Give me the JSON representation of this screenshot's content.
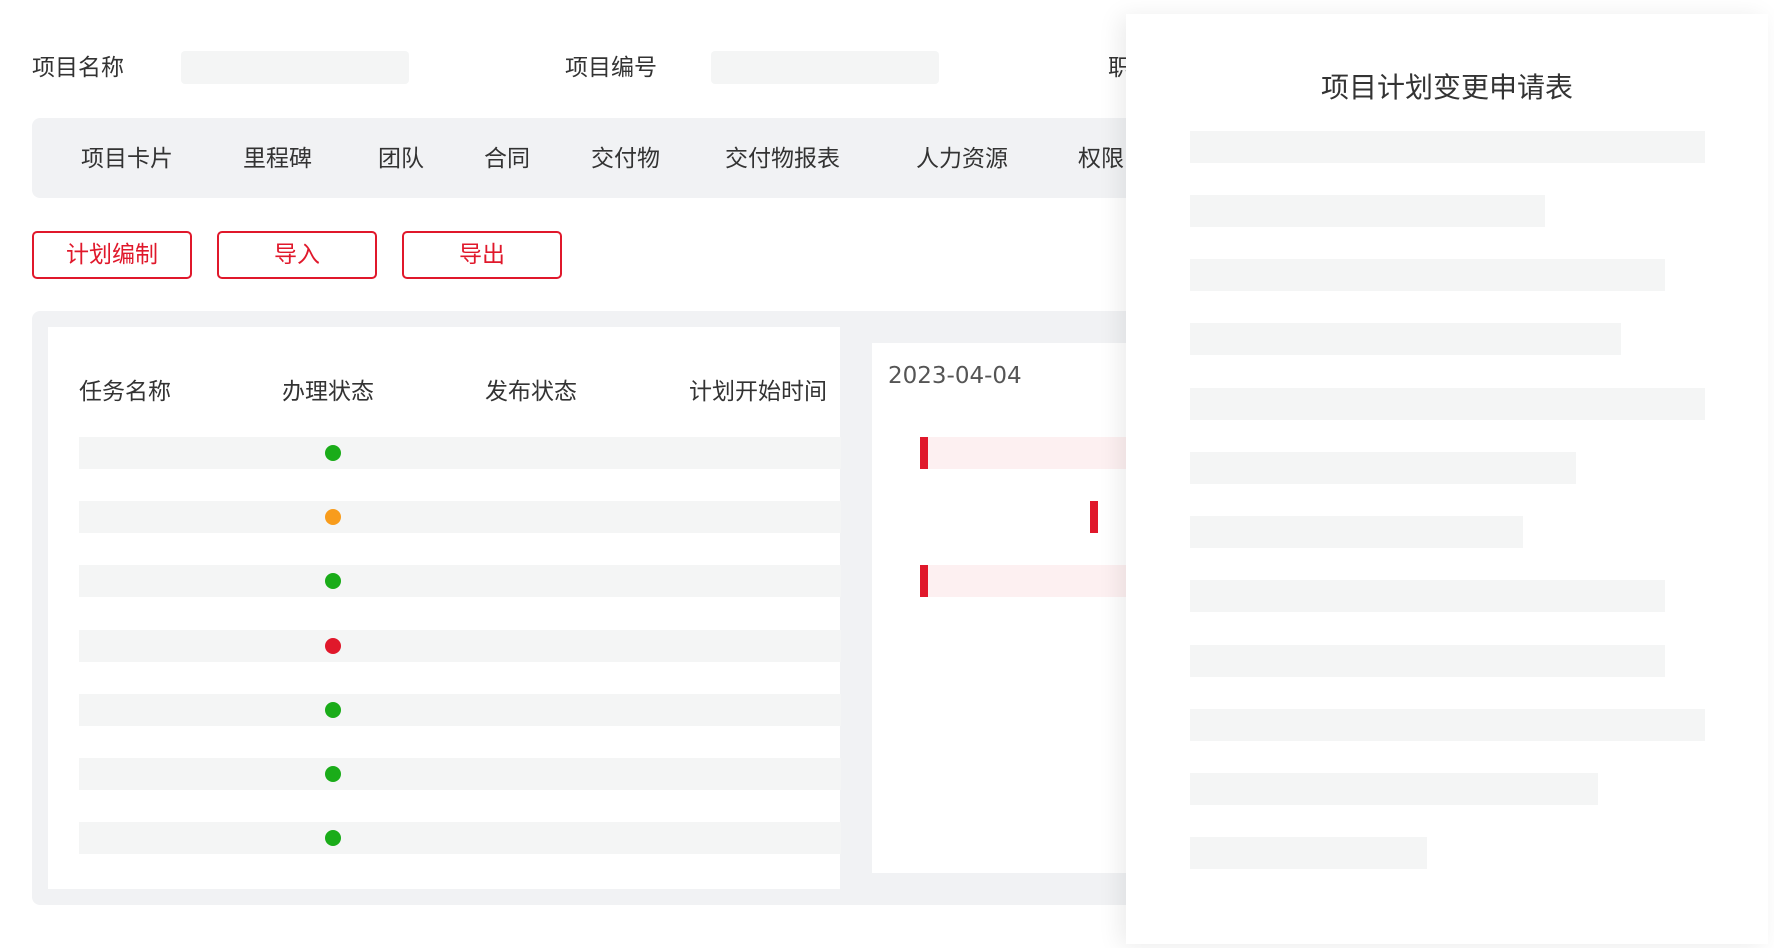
{
  "header": {
    "fields": [
      {
        "label": "项目名称"
      },
      {
        "label": "项目编号"
      },
      {
        "label": "职"
      }
    ]
  },
  "tabs": [
    "项目卡片",
    "里程碑",
    "团队",
    "合同",
    "交付物",
    "交付物报表",
    "人力资源",
    "权限"
  ],
  "actions": {
    "plan_edit": "计划编制",
    "import": "导入",
    "export": "导出"
  },
  "table": {
    "columns": [
      "任务名称",
      "办理状态",
      "发布状态",
      "计划开始时间"
    ],
    "rows": [
      {
        "status_color": "#1aac19"
      },
      {
        "status_color": "#f89c1c"
      },
      {
        "status_color": "#1aac19"
      },
      {
        "status_color": "#e0182b"
      },
      {
        "status_color": "#1aac19"
      },
      {
        "status_color": "#1aac19"
      },
      {
        "status_color": "#1aac19"
      }
    ]
  },
  "gantt": {
    "date": "2023-04-04"
  },
  "form_card": {
    "title": "项目计划变更申请表"
  },
  "colors": {
    "accent": "#e0182b",
    "status_done": "#1aac19",
    "status_warning": "#f89c1c",
    "status_error": "#e0182b"
  }
}
